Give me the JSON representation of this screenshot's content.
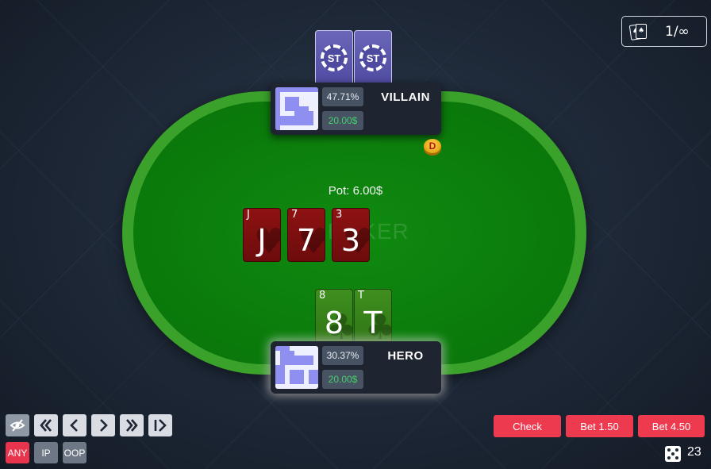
{
  "hand_counter": {
    "icon": "cards-icon",
    "value": "1/∞"
  },
  "table": {
    "logo_text": "S   POKER",
    "pot_label": "Pot: 6.00$",
    "dealer_button": "D"
  },
  "villain": {
    "name": "VILLAIN",
    "equity": "47.71%",
    "stack": "20.00$",
    "hole_cards": [
      {
        "back_logo": "ST"
      },
      {
        "back_logo": "ST"
      }
    ]
  },
  "hero": {
    "name": "HERO",
    "equity": "30.37%",
    "stack": "20.00$",
    "hole_cards": [
      {
        "rank": "8",
        "suit": "club",
        "suit_symbol": "♣"
      },
      {
        "rank": "T",
        "suit": "club",
        "suit_symbol": "♣"
      }
    ]
  },
  "board": [
    {
      "rank": "J",
      "suit": "heart",
      "suit_symbol": "♥"
    },
    {
      "rank": "7",
      "suit": "heart",
      "suit_symbol": "♥"
    },
    {
      "rank": "3",
      "suit": "heart",
      "suit_symbol": "♥"
    }
  ],
  "controls": {
    "nav_icons": [
      "eye-off-icon",
      "rewind-icon",
      "step-back-icon",
      "step-forward-icon",
      "fast-forward-icon",
      "skip-end-icon"
    ],
    "position_filters": [
      "ANY",
      "IP",
      "OOP"
    ]
  },
  "actions": [
    "Check",
    "Bet 1.50",
    "Bet 4.50"
  ],
  "dice": {
    "icon": "dice-icon",
    "value": "23"
  },
  "colors": {
    "felt": "#0a7a0b",
    "rail": "#3aa12a",
    "action_red": "#ee3a4e",
    "stack_green": "#45d06a",
    "card_back": "#4e4aa0"
  }
}
